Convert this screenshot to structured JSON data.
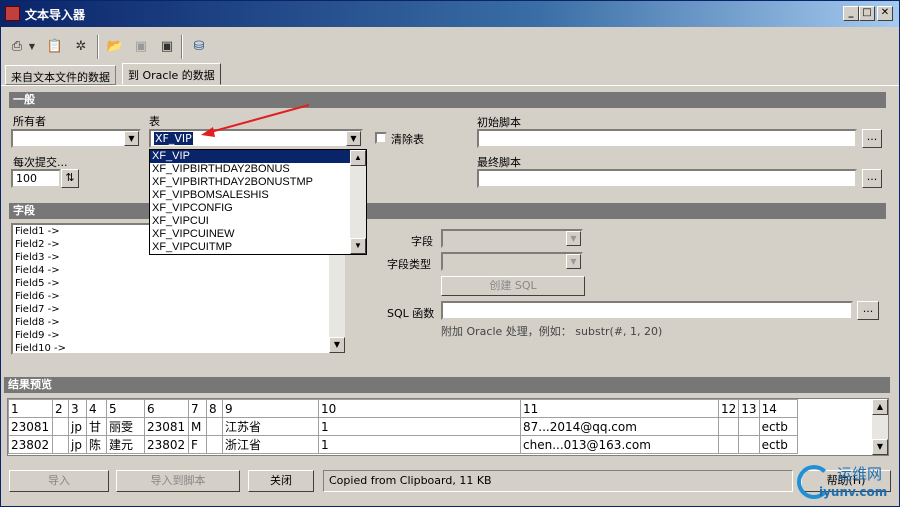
{
  "window": {
    "title": "文本导入器",
    "min": "_",
    "max": "□",
    "close": "✕"
  },
  "toolbar": {
    "icons": [
      "import-icon",
      "dropdown-arrow-icon",
      "paste-icon",
      "new-icon",
      "open-folder-icon",
      "save-disabled-icon",
      "save-icon",
      "database-icon"
    ]
  },
  "tabs": [
    {
      "label": "来自文本文件的数据"
    },
    {
      "label": "到 Oracle 的数据"
    }
  ],
  "general": {
    "section": "一般",
    "owner_label": "所有者",
    "owner_value": "",
    "table_label": "表",
    "table_value": "XF_VIP",
    "clear_label": "清除表",
    "commit_label": "每次提交...",
    "commit_value": "100",
    "init_script_label": "初始脚本",
    "final_script_label": "最终脚本",
    "dots": "..."
  },
  "dropdown": {
    "items": [
      "XF_VIP",
      "XF_VIPBIRTHDAY2BONUS",
      "XF_VIPBIRTHDAY2BONUSTMP",
      "XF_VIPBOMSALESHIS",
      "XF_VIPCONFIG",
      "XF_VIPCUI",
      "XF_VIPCUINEW",
      "XF_VIPCUITMP"
    ]
  },
  "fields": {
    "section": "字段",
    "list": [
      "Field1 ->",
      "Field2 ->",
      "Field3 ->",
      "Field4 ->",
      "Field5 ->",
      "Field6 ->",
      "Field7 ->",
      "Field8 ->",
      "Field9 ->",
      "Field10 ->"
    ],
    "field_label": "字段",
    "type_label": "字段类型",
    "create_sql": "创建 SQL",
    "sql_func_label": "SQL 函数",
    "hint": "附加 Oracle 处理，例如：  substr(#, 1, 20)"
  },
  "preview": {
    "section": "结果预览",
    "headers": [
      "1",
      "2",
      "3",
      "4",
      "5",
      "6",
      "7",
      "8",
      "9",
      "10",
      "11",
      "12",
      "13",
      "14"
    ],
    "rows": [
      [
        "23081",
        "",
        "jp",
        "甘",
        "丽雯",
        "23081",
        "M",
        "",
        "江苏省",
        "1",
        "87...2014@qq.com",
        "",
        "",
        "ectb"
      ],
      [
        "23802",
        "",
        "jp",
        "陈",
        "建元",
        "23802",
        "F",
        "",
        "浙江省",
        "1",
        "chen...013@163.com",
        "",
        "",
        "ectb"
      ]
    ]
  },
  "bottom": {
    "import": "导入",
    "import_script": "导入到脚本",
    "close": "关闭",
    "status": "Copied from Clipboard,  11 KB",
    "help": "帮助(H)"
  },
  "watermark": {
    "text": "运维网",
    "sub": "iyunv.com"
  }
}
